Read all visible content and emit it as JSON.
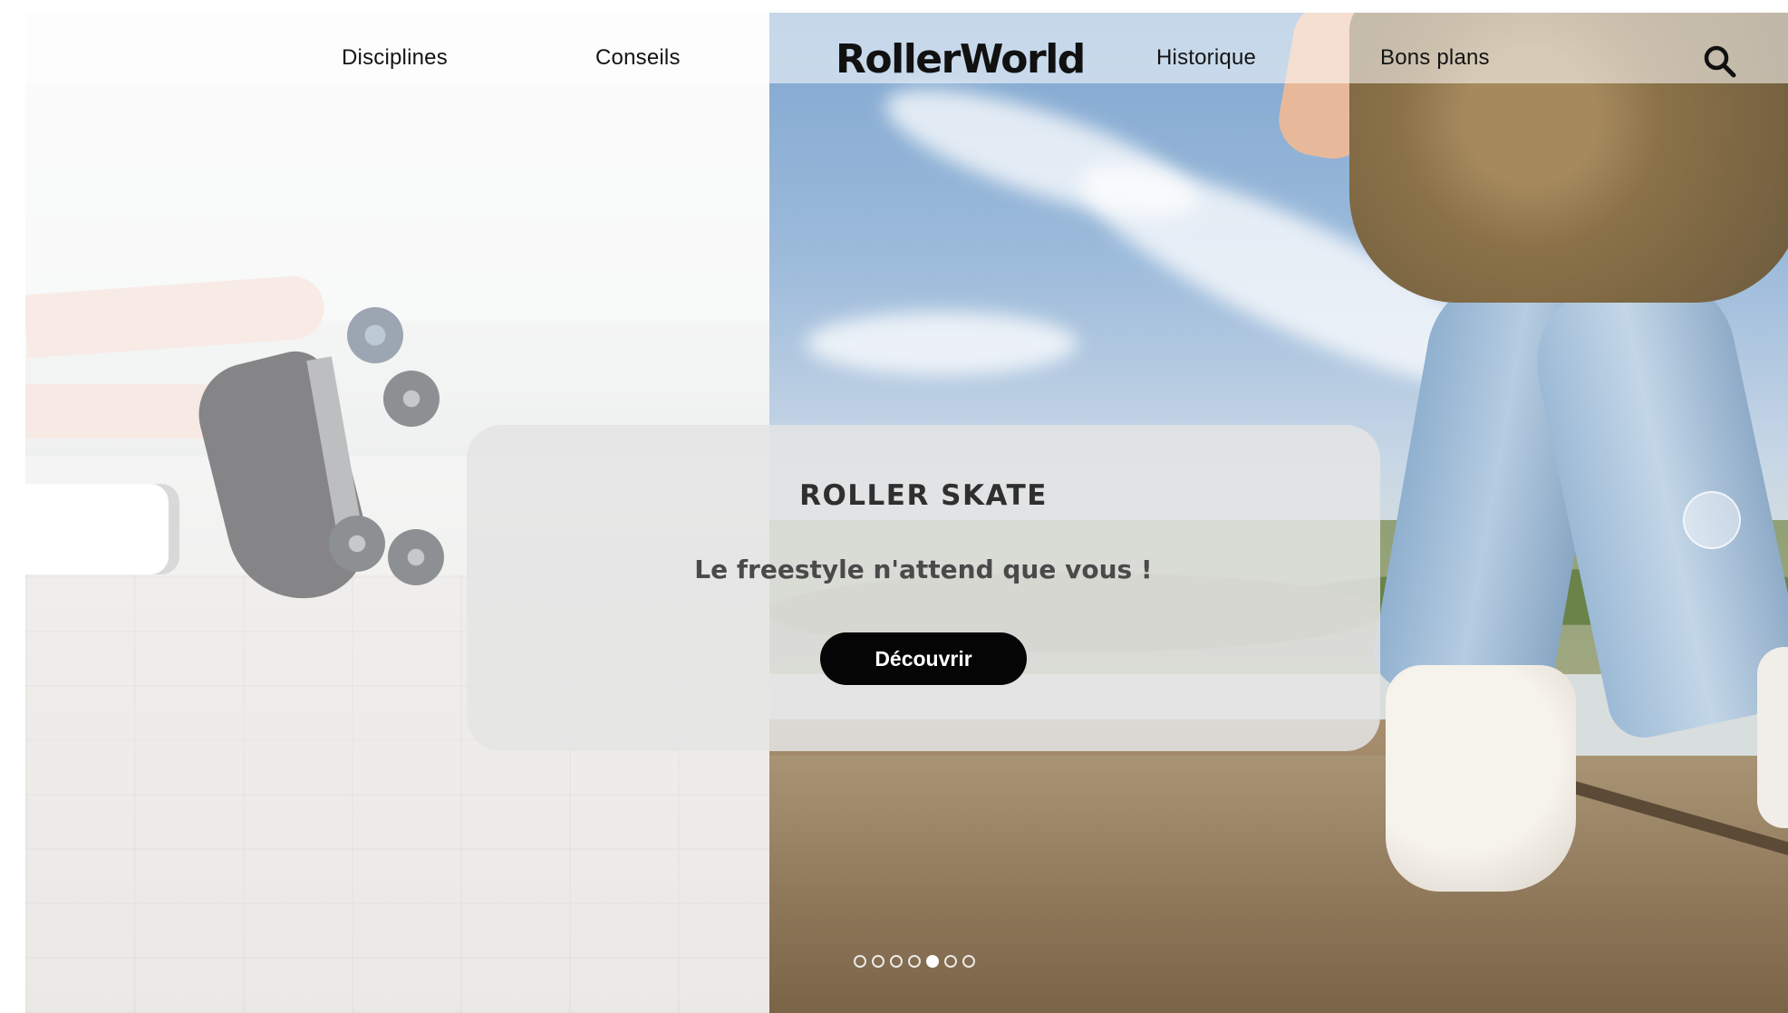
{
  "brand": {
    "logo_text": "RollerWorld"
  },
  "nav": {
    "items": [
      {
        "label": "Disciplines"
      },
      {
        "label": "Conseils"
      },
      {
        "label": "Historique"
      },
      {
        "label": "Bons plans"
      }
    ],
    "search_icon": "search-icon"
  },
  "hero": {
    "title": "ROLLER SKATE",
    "subtitle": "Le freestyle n'attend que vous !",
    "cta_label": "Découvrir",
    "slides": {
      "total": 7,
      "active_index": 4
    }
  },
  "colors": {
    "cta_background": "#050505",
    "cta_text": "#ffffff",
    "text_dark": "#141414",
    "card_background": "#e4e4e4"
  }
}
